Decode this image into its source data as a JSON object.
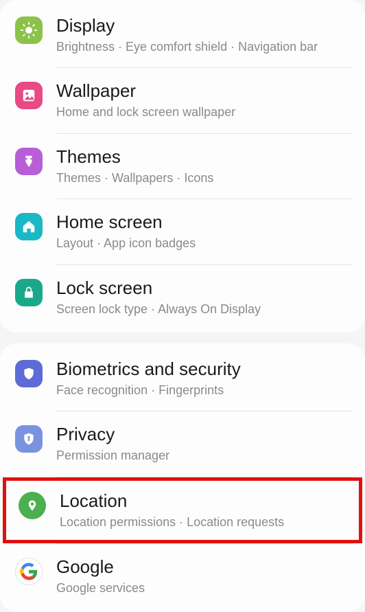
{
  "groups": [
    {
      "items": [
        {
          "id": "display",
          "title": "Display",
          "subtitle": "Brightness  ·  Eye comfort shield  ·  Navigation bar"
        },
        {
          "id": "wallpaper",
          "title": "Wallpaper",
          "subtitle": "Home and lock screen wallpaper"
        },
        {
          "id": "themes",
          "title": "Themes",
          "subtitle": "Themes  ·  Wallpapers  ·  Icons"
        },
        {
          "id": "home-screen",
          "title": "Home screen",
          "subtitle": "Layout  ·  App icon badges"
        },
        {
          "id": "lock-screen",
          "title": "Lock screen",
          "subtitle": "Screen lock type  ·  Always On Display"
        }
      ]
    },
    {
      "items": [
        {
          "id": "biometrics",
          "title": "Biometrics and security",
          "subtitle": "Face recognition  ·  Fingerprints"
        },
        {
          "id": "privacy",
          "title": "Privacy",
          "subtitle": "Permission manager"
        },
        {
          "id": "location",
          "title": "Location",
          "subtitle": "Location permissions  ·  Location requests",
          "highlighted": true
        },
        {
          "id": "google",
          "title": "Google",
          "subtitle": "Google services"
        }
      ]
    }
  ]
}
